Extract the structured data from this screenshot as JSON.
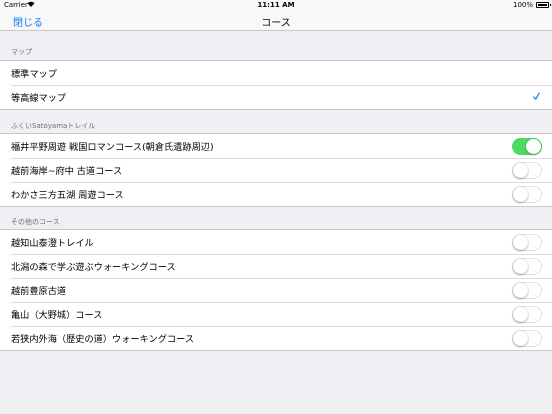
{
  "status_bar": {
    "carrier": "Carrier",
    "time": "11:11 AM",
    "battery": "100%"
  },
  "nav": {
    "close_label": "閉じる",
    "title": "コース"
  },
  "sections": [
    {
      "header": "マップ",
      "rows": [
        {
          "label": "標準マップ",
          "checked": false
        },
        {
          "label": "等高線マップ",
          "checked": true
        }
      ]
    },
    {
      "header": "ふくいSatoyamaトレイル",
      "rows": [
        {
          "label": "福井平野周遊 戦国ロマンコース(朝倉氏遺跡周辺)",
          "toggle": true
        },
        {
          "label": "越前海岸~府中 古道コース",
          "toggle": false
        },
        {
          "label": "わかさ三方五湖 周遊コース",
          "toggle": false
        }
      ]
    },
    {
      "header": "その他のコース",
      "rows": [
        {
          "label": "越知山泰澄トレイル",
          "toggle": false
        },
        {
          "label": "北潟の森で学ぶ遊ぶウォーキングコース",
          "toggle": false
        },
        {
          "label": "越前豊原古道",
          "toggle": false
        },
        {
          "label": "亀山（大野城）コース",
          "toggle": false
        },
        {
          "label": "若狭内外海（歴史の道）ウォーキングコース",
          "toggle": false
        }
      ]
    }
  ],
  "colors": {
    "accent": "#0a7afe",
    "toggle_on": "#4cd964",
    "background": "#efeff4"
  },
  "icons": {
    "wifi": "wifi-icon",
    "battery": "battery-icon",
    "check": "checkmark-icon"
  }
}
